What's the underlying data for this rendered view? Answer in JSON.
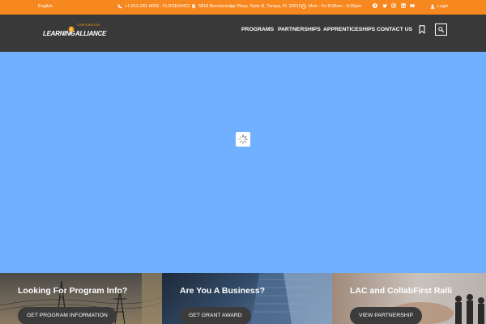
{
  "topbar": {
    "language": "English",
    "phone": "+1 813-281-8658 - FLDOE#3422",
    "address": "5818 Breckenridge Pkwy. Suite B, Tampa, FL 33610",
    "hours": "Mon - Fri 8:00am - 6:00pm",
    "social_icons": [
      "facebook-icon",
      "twitter-icon",
      "instagram-icon",
      "linkedin-icon",
      "youtube-icon"
    ],
    "login_label": "Login"
  },
  "header": {
    "logo": {
      "word1": "LEARNING",
      "word2": "ALLIANCE",
      "tagline": "CORPORATION"
    },
    "nav": [
      {
        "label": "PROGRAMS"
      },
      {
        "label": "PARTNERSHIPS"
      },
      {
        "label": "APPRENTICESHIPS"
      },
      {
        "label": "CONTACT US"
      }
    ]
  },
  "colors": {
    "topbar": "#f7871f",
    "header": "#3a3939",
    "hero": "#6fb1ff",
    "button": "#3b3b3b"
  },
  "panels": [
    {
      "title": "Looking For Program Info?",
      "button": "GET PROGRAM INFORMATION"
    },
    {
      "title": "Are You A Business?",
      "button": "GET GRANT AWARD"
    },
    {
      "title": "LAC and CollabFirst Ralli",
      "button": "VIEW PARTNERSHIP"
    }
  ]
}
